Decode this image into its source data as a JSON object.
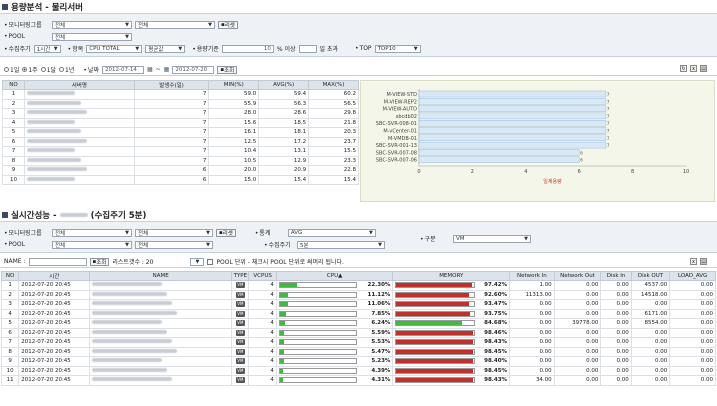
{
  "section1": {
    "title": "용량분석 - 물리서버"
  },
  "filter1": {
    "group_label": "모니터링그룹",
    "group_val1": "전체",
    "group_val2": "전체",
    "reset": "리셋",
    "pool_label": "POOL",
    "pool_val": "전체",
    "period_label": "수집주기",
    "period_val": "1시간",
    "item_label": "항목",
    "item_val": "CPU TOTAL",
    "agg_val": "평균값",
    "threshold_label": "용량기준",
    "threshold_val": "10",
    "threshold_suffix": "% 이상",
    "exceed_label": "일 초과",
    "top_label": "TOP",
    "top_val": "TOP10"
  },
  "datebar": {
    "r1": "1일",
    "r2": "1주",
    "r3": "1달",
    "r4": "1년",
    "date_label": "날짜",
    "from": "2012-07-14",
    "to": "2012-07-20",
    "search": "조회"
  },
  "table1": {
    "headers": [
      "NO",
      "서버명",
      "발생수(일)",
      "MIN(%)",
      "AVG(%)",
      "MAX(%)"
    ],
    "rows": [
      [
        "1",
        "7",
        "59.0",
        "59.4",
        "60.2"
      ],
      [
        "2",
        "7",
        "55.9",
        "56.3",
        "56.5"
      ],
      [
        "3",
        "7",
        "28.0",
        "28.6",
        "29.8"
      ],
      [
        "4",
        "7",
        "15.6",
        "18.5",
        "21.8"
      ],
      [
        "5",
        "7",
        "16.1",
        "18.1",
        "20.3"
      ],
      [
        "6",
        "7",
        "12.5",
        "17.2",
        "23.7"
      ],
      [
        "7",
        "7",
        "10.4",
        "13.1",
        "15.5"
      ],
      [
        "8",
        "7",
        "10.5",
        "12.9",
        "23.3"
      ],
      [
        "9",
        "6",
        "20.0",
        "20.9",
        "22.8"
      ],
      [
        "10",
        "6",
        "15.0",
        "15.4",
        "15.4"
      ]
    ]
  },
  "chart_data": {
    "type": "bar",
    "categories": [
      "M-VIEW-STD",
      "M-VIEW-REP2",
      "M-VIEW-AUTO",
      "sbcdb02",
      "SBC-SVR-008-01",
      "M-vCenter-01",
      "M-VMDB-01",
      "SBC-SVR-001-13",
      "SBC-SVR-007-08",
      "SBC-SVR-007-06"
    ],
    "values": [
      7,
      7,
      7,
      7,
      7,
      7,
      7,
      7,
      6,
      6
    ],
    "xlim": [
      0,
      10
    ],
    "xticks": [
      "0",
      "2",
      "4",
      "6",
      "8",
      "10"
    ],
    "xlabel": "일계용량",
    "bar_color": "#d7e8f7"
  },
  "section2": {
    "title_prefix": "실시간성능 - ",
    "title_suffix": "(수집주기 5분)"
  },
  "filter2": {
    "group_label": "모니터링그룹",
    "group_val1": "전체",
    "group_val2": "전체",
    "reset": "리셋",
    "pool_label": "POOL",
    "pool_val1": "전체",
    "pool_val2": "전체",
    "stat_label": "통계",
    "stat_val": "AVG",
    "period_label": "수집주기",
    "period_val": "5분",
    "kind_label": "구분",
    "kind_val": "VM"
  },
  "namebar": {
    "name_label": "NAME :",
    "search": "조회",
    "list_label": "리스트갯수 : 20",
    "pool_check": "POOL 단위 - 체크시 POOL 단위로 써머리 됩니다."
  },
  "table2": {
    "headers": [
      "NO",
      "시간",
      "NAME",
      "TYPE",
      "VCPUS",
      "CPU",
      "MEMORY",
      "Network In",
      "Network Out",
      "Disk In",
      "Disk OUT",
      "LOAD_AVG"
    ],
    "type_label": "VM",
    "rows": [
      {
        "no": "1",
        "time": "2012-07-20 20:45",
        "vcpu": "4",
        "cpu": "22.30%",
        "cpu_v": 22.3,
        "mem": "97.42%",
        "mem_v": 97.42,
        "ni": "1.00",
        "no_": "0.00",
        "di": "0.00",
        "do": "4537.00",
        "la": "0.00"
      },
      {
        "no": "2",
        "time": "2012-07-20 20:45",
        "vcpu": "4",
        "cpu": "11.12%",
        "cpu_v": 11.12,
        "mem": "92.60%",
        "mem_v": 92.6,
        "ni": "11313.00",
        "no_": "0.00",
        "di": "0.00",
        "do": "14518.00",
        "la": "0.00"
      },
      {
        "no": "3",
        "time": "2012-07-20 20:45",
        "vcpu": "4",
        "cpu": "11.06%",
        "cpu_v": 11.06,
        "mem": "93.47%",
        "mem_v": 93.47,
        "ni": "0.00",
        "no_": "0.00",
        "di": "0.00",
        "do": "0.00",
        "la": "0.00"
      },
      {
        "no": "4",
        "time": "2012-07-20 20:45",
        "vcpu": "4",
        "cpu": "7.85%",
        "cpu_v": 7.85,
        "mem": "93.75%",
        "mem_v": 93.75,
        "ni": "0.00",
        "no_": "0.00",
        "di": "0.00",
        "do": "6171.00",
        "la": "0.00"
      },
      {
        "no": "5",
        "time": "2012-07-20 20:45",
        "vcpu": "4",
        "cpu": "6.24%",
        "cpu_v": 6.24,
        "mem": "84.68%",
        "mem_v": 84.68,
        "ni": "0.00",
        "no_": "39778.00",
        "di": "0.00",
        "do": "8554.00",
        "la": "0.00"
      },
      {
        "no": "6",
        "time": "2012-07-20 20:45",
        "vcpu": "4",
        "cpu": "5.59%",
        "cpu_v": 5.59,
        "mem": "98.46%",
        "mem_v": 98.46,
        "ni": "0.00",
        "no_": "0.00",
        "di": "0.00",
        "do": "0.00",
        "la": "0.00"
      },
      {
        "no": "7",
        "time": "2012-07-20 20:45",
        "vcpu": "4",
        "cpu": "5.53%",
        "cpu_v": 5.53,
        "mem": "98.43%",
        "mem_v": 98.43,
        "ni": "0.00",
        "no_": "0.00",
        "di": "0.00",
        "do": "0.00",
        "la": "0.00"
      },
      {
        "no": "8",
        "time": "2012-07-20 20:45",
        "vcpu": "4",
        "cpu": "5.47%",
        "cpu_v": 5.47,
        "mem": "98.45%",
        "mem_v": 98.45,
        "ni": "0.00",
        "no_": "0.00",
        "di": "0.00",
        "do": "0.00",
        "la": "0.00"
      },
      {
        "no": "9",
        "time": "2012-07-20 20:45",
        "vcpu": "4",
        "cpu": "5.23%",
        "cpu_v": 5.23,
        "mem": "98.40%",
        "mem_v": 98.4,
        "ni": "0.00",
        "no_": "0.00",
        "di": "0.00",
        "do": "0.00",
        "la": "0.00"
      },
      {
        "no": "10",
        "time": "2012-07-20 20:45",
        "vcpu": "4",
        "cpu": "4.39%",
        "cpu_v": 4.39,
        "mem": "98.45%",
        "mem_v": 98.45,
        "ni": "0.00",
        "no_": "0.00",
        "di": "0.00",
        "do": "0.00",
        "la": "0.00"
      },
      {
        "no": "11",
        "time": "2012-07-20 20:45",
        "vcpu": "4",
        "cpu": "4.31%",
        "cpu_v": 4.31,
        "mem": "98.43%",
        "mem_v": 98.43,
        "ni": "34.00",
        "no_": "0.00",
        "di": "0.00",
        "do": "0.00",
        "la": "0.00"
      }
    ]
  },
  "colors": {
    "cpu_fill": "#3fb93f",
    "mem_fill": "#c0302c",
    "header_bg": "#dde3ea"
  }
}
